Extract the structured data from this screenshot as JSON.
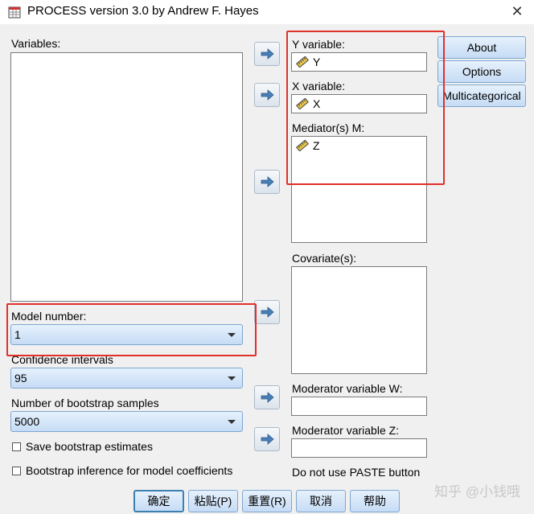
{
  "window": {
    "title": "PROCESS version 3.0 by Andrew F. Hayes",
    "close_glyph": "✕"
  },
  "variables": {
    "label": "Variables:"
  },
  "model": {
    "label": "Model number:",
    "value": "1"
  },
  "confidence": {
    "label": "Confidence intervals",
    "value": "95"
  },
  "bootstrap": {
    "label": "Number of bootstrap samples",
    "value": "5000"
  },
  "checkboxes": {
    "save_estimates": {
      "label": "Save bootstrap estimates",
      "checked": false
    },
    "inference": {
      "label": "Bootstrap inference for model coefficients",
      "checked": false
    }
  },
  "y_variable": {
    "label": "Y variable:",
    "value": "Y",
    "icon": "ruler-icon"
  },
  "x_variable": {
    "label": "X variable:",
    "value": "X",
    "icon": "ruler-icon"
  },
  "mediators": {
    "label": "Mediator(s) M:",
    "items": [
      "Z"
    ],
    "icon": "ruler-icon"
  },
  "covariates": {
    "label": "Covariate(s):"
  },
  "moderator_w": {
    "label": "Moderator variable W:",
    "value": ""
  },
  "moderator_z": {
    "label": "Moderator variable Z:",
    "value": ""
  },
  "paste_note": "Do not use PASTE button",
  "side_buttons": {
    "about": "About",
    "options": "Options",
    "multicategorical": "Multicategorical"
  },
  "bottom_buttons": {
    "ok": "确定",
    "paste": "粘贴(P)",
    "reset": "重置(R)",
    "cancel": "取消",
    "help": "帮助"
  },
  "watermark": "知乎 @小钱哦",
  "colors": {
    "highlight_box": "#e0302a",
    "button_gradient_top": "#e6f1fc",
    "button_gradient_bottom": "#c6dcf5"
  }
}
